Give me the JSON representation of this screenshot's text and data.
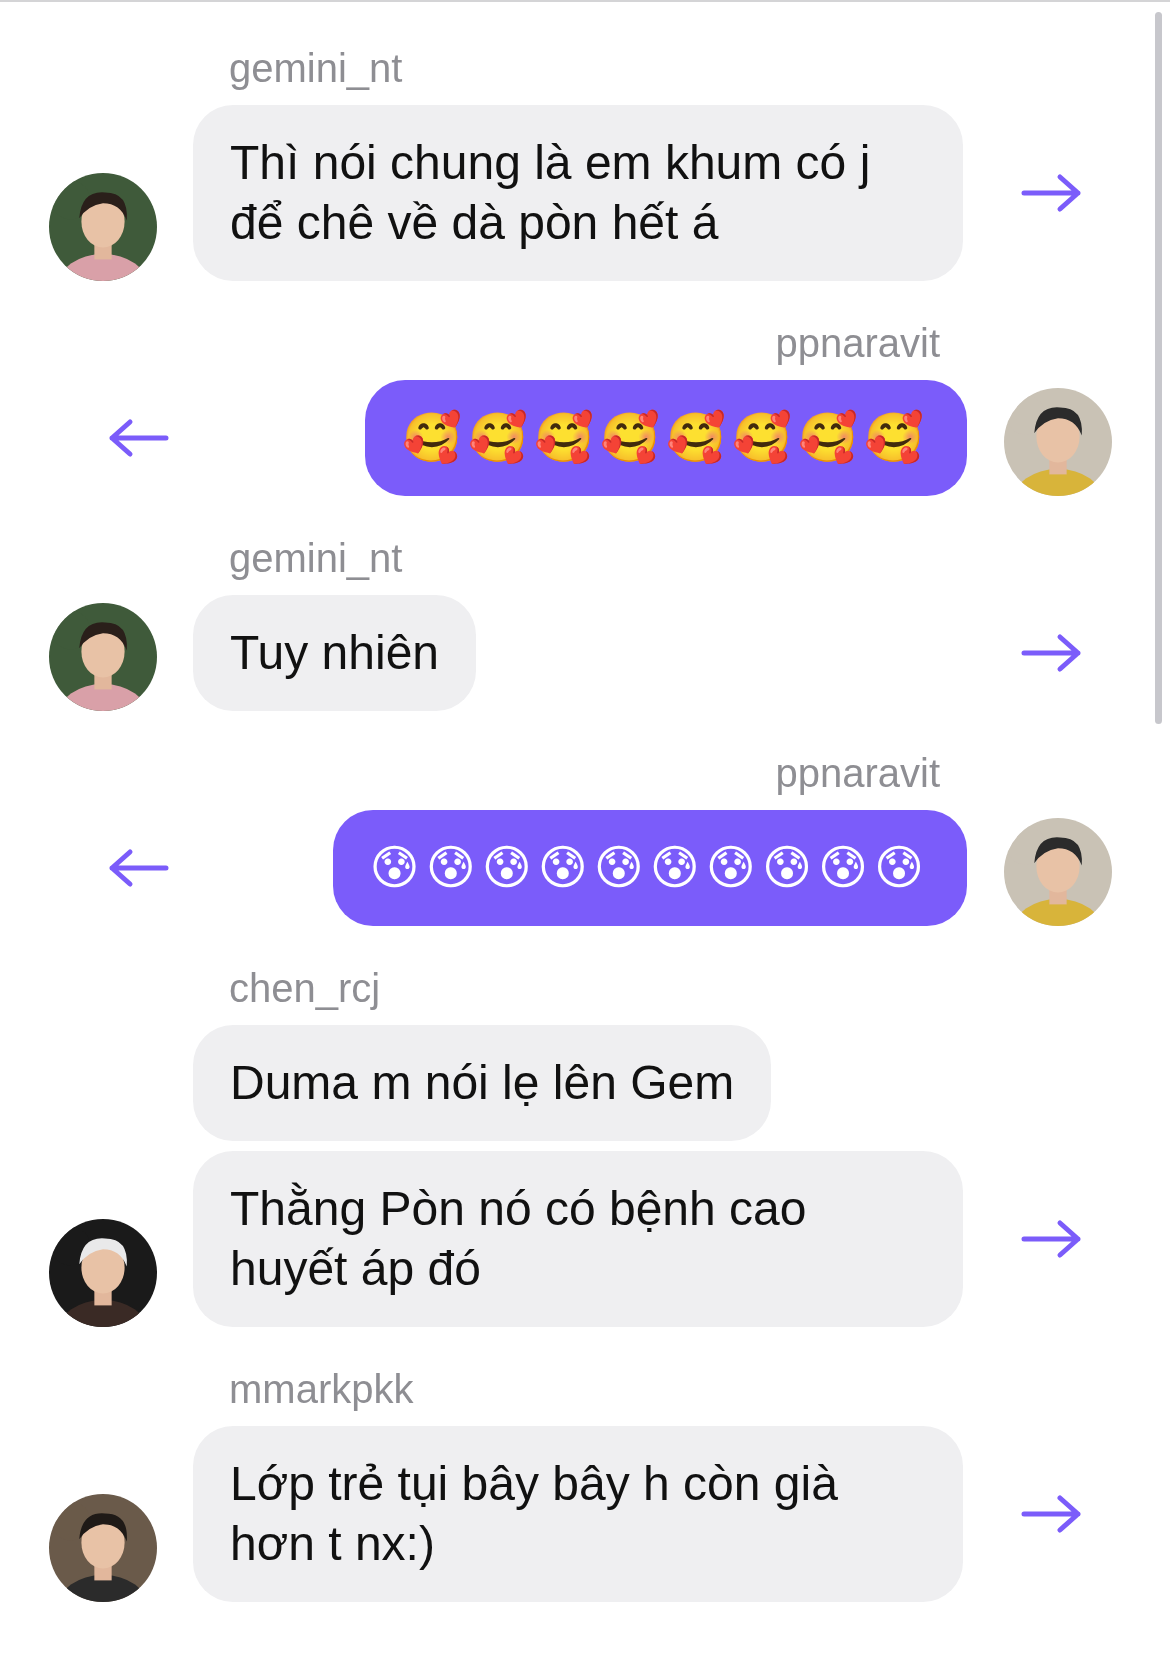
{
  "groups": [
    {
      "kind": "incoming",
      "username": "gemini_nt",
      "messages": [
        "Thì nói chung là em khum có j để chê về dà pòn hết á"
      ]
    },
    {
      "kind": "outgoing",
      "username": "ppnaravit",
      "messages": [
        "🥰🥰🥰🥰🥰🥰🥰🥰"
      ]
    },
    {
      "kind": "incoming",
      "username": "gemini_nt",
      "messages": [
        "Tuy nhiên"
      ]
    },
    {
      "kind": "outgoing",
      "username": "ppnaravit",
      "messages": [
        "😰😰😰😰😰😰😰😰😰😰"
      ]
    },
    {
      "kind": "incoming",
      "username": "chen_rcj",
      "messages": [
        "Duma m nói lẹ lên Gem",
        "Thằng Pòn nó có bệnh cao huyết áp đó"
      ]
    },
    {
      "kind": "incoming",
      "username": "mmarkpkk",
      "messages": [
        "Lớp trẻ tụi bây bây h còn già hơn t nx:)"
      ]
    }
  ]
}
